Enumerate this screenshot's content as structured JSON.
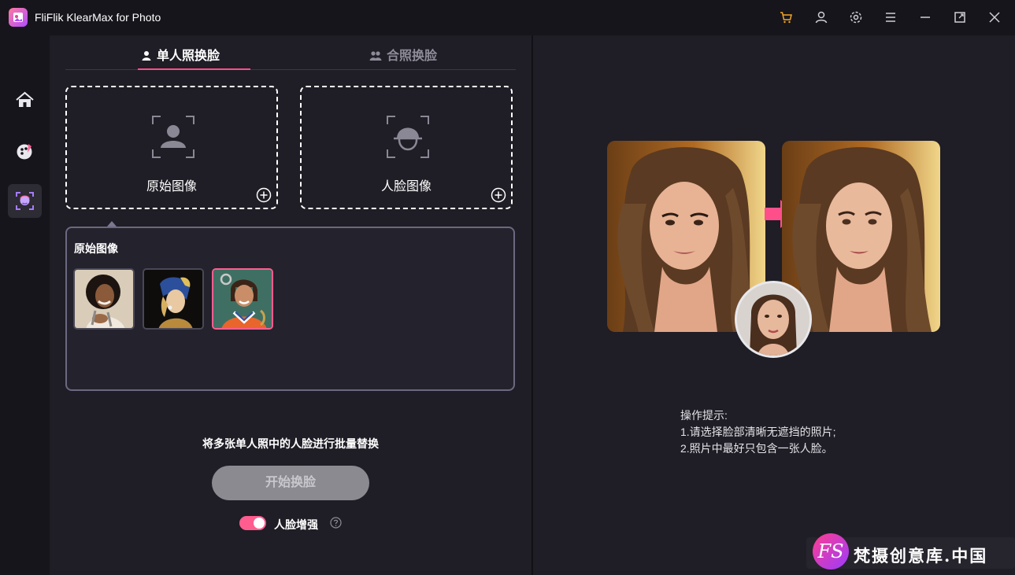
{
  "app": {
    "title": "FliFlik KlearMax for Photo"
  },
  "titlebar": {
    "icons": [
      "cart-icon",
      "user-icon",
      "settings-icon",
      "menu-icon",
      "minimize-icon",
      "maximize-icon",
      "close-icon"
    ],
    "cart_color": "#f5a623"
  },
  "sidebar": {
    "items": [
      {
        "name": "home",
        "icon": "home-icon"
      },
      {
        "name": "enhance",
        "icon": "palette-icon"
      },
      {
        "name": "face-swap",
        "icon": "face-swap-icon",
        "active": true
      }
    ]
  },
  "tabs": [
    {
      "label": "单人照换脸",
      "active": true
    },
    {
      "label": "合照换脸",
      "active": false
    }
  ],
  "drop_zones": {
    "original_label": "原始图像",
    "face_label": "人脸图像"
  },
  "gallery": {
    "title": "原始图像",
    "selected_index": 2
  },
  "batch_text": "将多张单人照中的人脸进行批量替换",
  "start_button": "开始换脸",
  "enhance": {
    "label": "人脸增强",
    "enabled": true
  },
  "tips": {
    "title": "操作提示:",
    "line1": "1.请选择脸部清晰无遮挡的照片;",
    "line2": "2.照片中最好只包含一张人脸。"
  },
  "watermark": {
    "logo": "FS",
    "text": "梵摄创意库.中国"
  },
  "colors": {
    "accent": "#ff5d8f",
    "background": "#1f1d25"
  }
}
